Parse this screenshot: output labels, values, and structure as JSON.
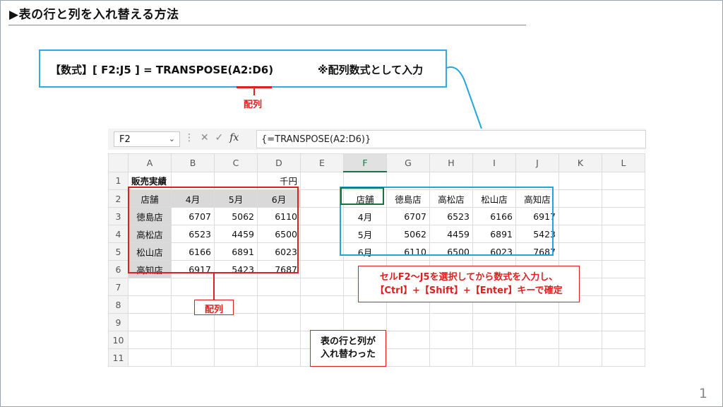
{
  "slide": {
    "title": "▶表の行と列を入れ替える方法",
    "page_number": "1"
  },
  "formula": {
    "prefix": "【数式】[ F2:J5 ] = TRANSPOSE(",
    "arg": "A2:D6",
    "suffix": ")",
    "note": "※配列数式として入力",
    "array_label": "配列"
  },
  "excel": {
    "name_box": "F2",
    "formula_bar": "{=TRANSPOSE(A2:D6)}",
    "fx_label": "fx",
    "columns": [
      "A",
      "B",
      "C",
      "D",
      "E",
      "F",
      "G",
      "H",
      "I",
      "J",
      "K",
      "L"
    ],
    "rows": [
      [
        "販売実績",
        "",
        "",
        "千円",
        "",
        "",
        "",
        "",
        "",
        "",
        "",
        ""
      ],
      [
        "店舗",
        "4月",
        "5月",
        "6月",
        "",
        "店舗",
        "徳島店",
        "高松店",
        "松山店",
        "高知店",
        "",
        ""
      ],
      [
        "徳島店",
        "6707",
        "5062",
        "6110",
        "",
        "4月",
        "6707",
        "6523",
        "6166",
        "6917",
        "",
        ""
      ],
      [
        "高松店",
        "6523",
        "4459",
        "6500",
        "",
        "5月",
        "5062",
        "4459",
        "6891",
        "5423",
        "",
        ""
      ],
      [
        "松山店",
        "6166",
        "6891",
        "6023",
        "",
        "6月",
        "6110",
        "6500",
        "6023",
        "7687",
        "",
        ""
      ],
      [
        "高知店",
        "6917",
        "5423",
        "7687",
        "",
        "",
        "",
        "",
        "",
        "",
        "",
        ""
      ],
      [
        "",
        "",
        "",
        "",
        "",
        "",
        "",
        "",
        "",
        "",
        "",
        ""
      ],
      [
        "",
        "",
        "",
        "",
        "",
        "",
        "",
        "",
        "",
        "",
        "",
        ""
      ],
      [
        "",
        "",
        "",
        "",
        "",
        "",
        "",
        "",
        "",
        "",
        "",
        ""
      ],
      [
        "",
        "",
        "",
        "",
        "",
        "",
        "",
        "",
        "",
        "",
        "",
        ""
      ],
      [
        "",
        "",
        "",
        "",
        "",
        "",
        "",
        "",
        "",
        "",
        "",
        ""
      ]
    ]
  },
  "annotations": {
    "array_label": "配列",
    "instruction_line1": "セルF2～J5を選択してから数式を入力し、",
    "instruction_line2": "【Ctrl】+【Shift】+【Enter】キーで確定",
    "result_line1": "表の行と列が",
    "result_line2": "入れ替わった"
  },
  "colors": {
    "red": "#e02020",
    "blue": "#20a6db",
    "excel_green": "#1a7340"
  }
}
